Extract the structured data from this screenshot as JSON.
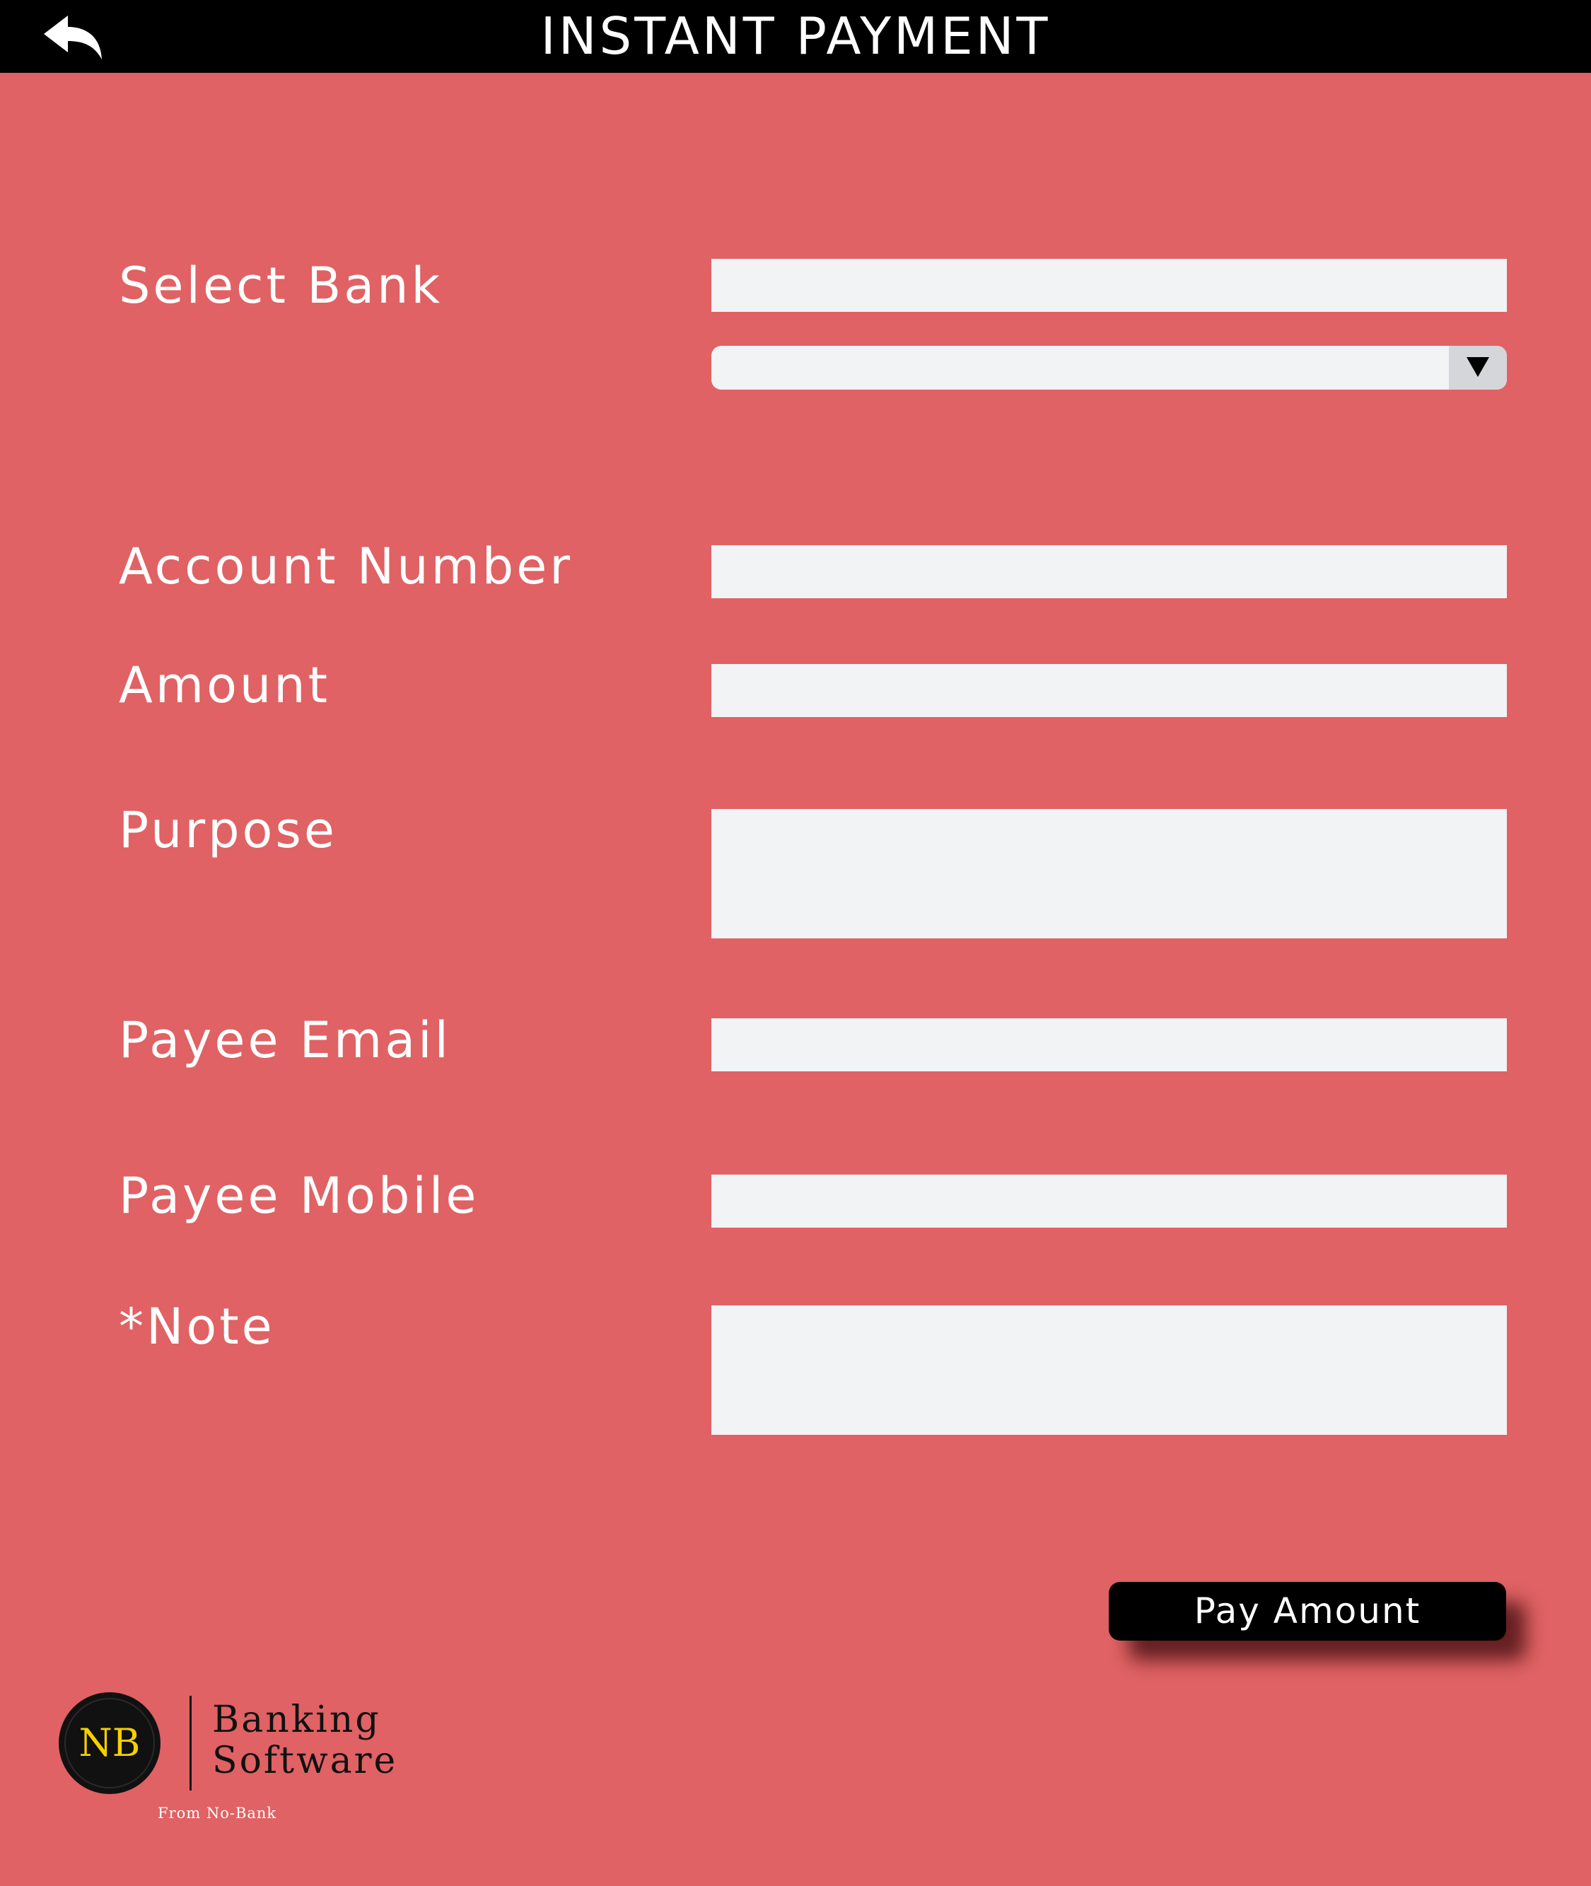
{
  "header": {
    "title": "INSTANT PAYMENT",
    "back_icon": "back-arrow-icon"
  },
  "form": {
    "select_bank": {
      "label": "Select Bank",
      "search_value": "",
      "dropdown_selected": "",
      "dropdown_icon": "triangle-down-icon"
    },
    "account_number": {
      "label": "Account Number",
      "value": ""
    },
    "amount": {
      "label": "Amount",
      "value": ""
    },
    "purpose": {
      "label": "Purpose",
      "value": ""
    },
    "payee_email": {
      "label": "Payee Email",
      "value": ""
    },
    "payee_mobile": {
      "label": "Payee Mobile",
      "value": ""
    },
    "note": {
      "label": "*Note",
      "value": ""
    }
  },
  "actions": {
    "pay_label": "Pay Amount"
  },
  "branding": {
    "monogram": "NB",
    "line1": "Banking",
    "line2": "Software",
    "tagline": "From No-Bank",
    "monogram_color": "#f5d000"
  },
  "colors": {
    "background": "#e06264",
    "header": "#000000",
    "field": "#f2f3f5",
    "button": "#000000"
  }
}
